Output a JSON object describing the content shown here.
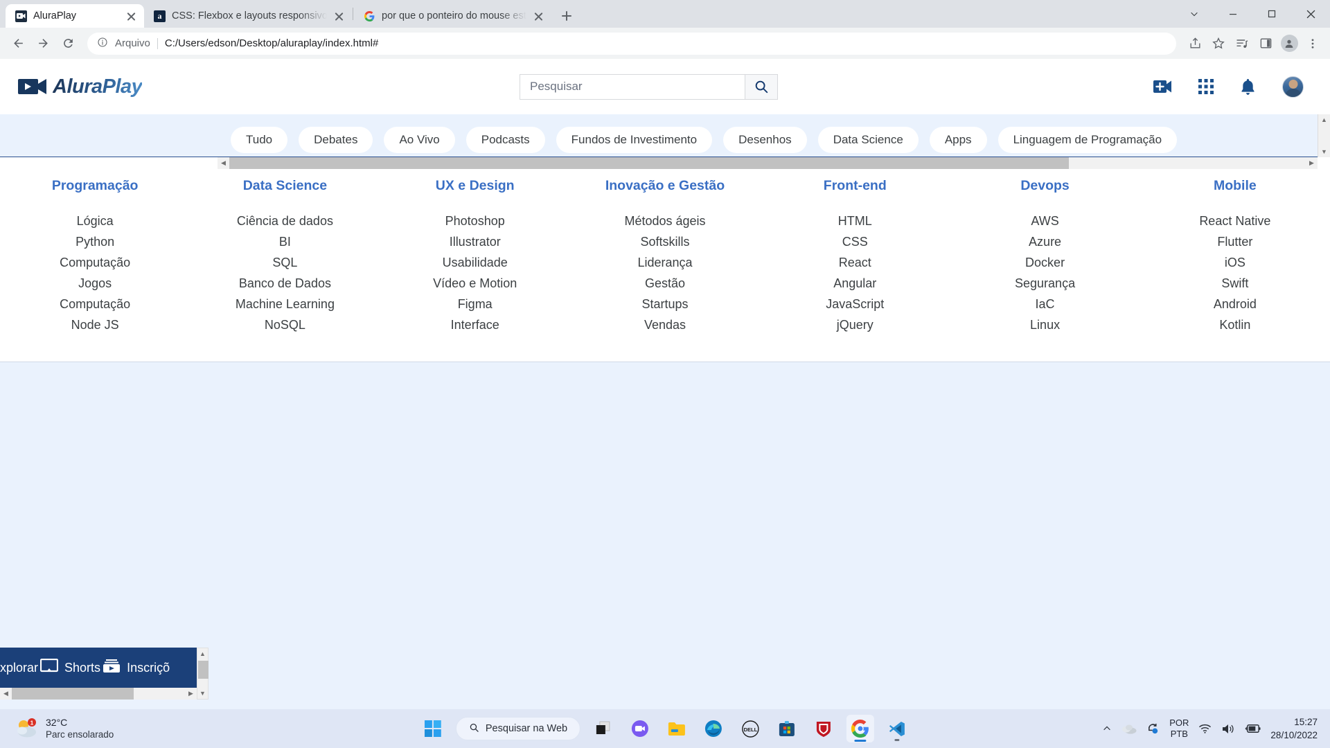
{
  "browser": {
    "tabs": [
      {
        "title": "AluraPlay",
        "favicon": "aluraplay-icon",
        "active": true
      },
      {
        "title": "CSS: Flexbox e layouts responsivo",
        "favicon": "alura-icon",
        "active": false
      },
      {
        "title": "por que o ponteiro do mouse est",
        "favicon": "google-icon",
        "active": false
      }
    ],
    "newtab_label": "+",
    "window_controls": {
      "minimize": "–",
      "maximize": "☐",
      "close": "✕",
      "chevron": "∨"
    },
    "omnibox": {
      "security_label": "Arquivo",
      "url": "C:/Users/edson/Desktop/aluraplay/index.html#"
    },
    "nav": {
      "back": "back-arrow",
      "forward": "forward-arrow",
      "reload": "reload-icon"
    },
    "toolbar_icons": [
      "share-icon",
      "bookmark-star-icon",
      "reading-list-icon",
      "side-panel-icon",
      "profile-avatar-icon",
      "chrome-menu-icon"
    ]
  },
  "site": {
    "logo_text": "AluraPlay",
    "search": {
      "placeholder": "Pesquisar",
      "value": "",
      "button": "search-icon"
    },
    "header_icons": [
      "create-video-icon",
      "apps-grid-icon",
      "notifications-bell-icon",
      "user-avatar"
    ],
    "pills": [
      "Tudo",
      "Debates",
      "Ao Vivo",
      "Podcasts",
      "Fundos de Investimento",
      "Desenhos",
      "Data Science",
      "Apps",
      "Linguagem de Programação"
    ],
    "menu_columns": [
      {
        "title": "Programação",
        "items": [
          "Lógica",
          "Python",
          "Computação",
          "Jogos",
          "Computação",
          "Node JS"
        ]
      },
      {
        "title": "Data Science",
        "items": [
          "Ciência de dados",
          "BI",
          "SQL",
          "Banco de Dados",
          "Machine Learning",
          "NoSQL"
        ]
      },
      {
        "title": "UX e Design",
        "items": [
          "Photoshop",
          "Illustrator",
          "Usabilidade",
          "Vídeo e Motion",
          "Figma",
          "Interface"
        ]
      },
      {
        "title": "Inovação e Gestão",
        "items": [
          "Métodos ágeis",
          "Softskills",
          "Liderança",
          "Gestão",
          "Startups",
          "Vendas"
        ]
      },
      {
        "title": "Front-end",
        "items": [
          "HTML",
          "CSS",
          "React",
          "Angular",
          "JavaScript",
          "jQuery"
        ]
      },
      {
        "title": "Devops",
        "items": [
          "AWS",
          "Azure",
          "Docker",
          "Segurança",
          "IaC",
          "Linux"
        ]
      },
      {
        "title": "Mobile",
        "items": [
          "React Native",
          "Flutter",
          "iOS",
          "Swift",
          "Android",
          "Kotlin"
        ]
      }
    ],
    "colors": {
      "accent_blue": "#3a6fc4",
      "page_bg": "#eaf2fd",
      "navy": "#1b4079"
    }
  },
  "overlay_panel": {
    "items": [
      {
        "label": "xplorar",
        "icon": "explore-icon"
      },
      {
        "label": "Shorts",
        "icon": "shorts-icon"
      },
      {
        "label": "Inscriçõ",
        "icon": ""
      }
    ]
  },
  "taskbar": {
    "weather": {
      "temperature": "32°C",
      "condition": "Parc ensolarado",
      "badge": "1"
    },
    "start_label": "start-icon",
    "search_placeholder": "Pesquisar na Web",
    "apps": [
      "task-view-icon",
      "chat-icon",
      "file-explorer-icon",
      "edge-icon",
      "dell-icon",
      "microsoft-store-icon",
      "mcafee-icon",
      "chrome-icon",
      "vscode-icon"
    ],
    "tray": {
      "chevron": "show-hidden-icons",
      "cloud": "onedrive-icon",
      "sync": "sync-icon",
      "language_top": "POR",
      "language_bottom": "PTB",
      "wifi": "wifi-icon",
      "volume": "volume-icon",
      "battery": "battery-charging-icon",
      "time": "15:27",
      "date": "28/10/2022"
    }
  }
}
